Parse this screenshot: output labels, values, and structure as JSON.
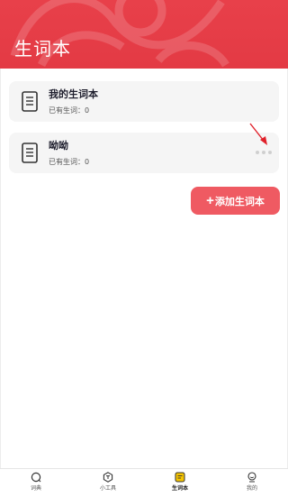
{
  "header": {
    "title": "生词本"
  },
  "wordbooks": [
    {
      "title": "我的生词本",
      "count_text": "已有生词：0"
    },
    {
      "title": "呦呦",
      "count_text": "已有生词：0"
    }
  ],
  "add_button": {
    "label": "添加生词本"
  },
  "tabs": [
    {
      "label": "词典",
      "icon": "search-icon"
    },
    {
      "label": "小工具",
      "icon": "tools-icon"
    },
    {
      "label": "生词本",
      "icon": "notebook-icon",
      "active": true
    },
    {
      "label": "我的",
      "icon": "profile-icon"
    }
  ],
  "colors": {
    "brand_red": "#e33a44",
    "button_red": "#ef5a62",
    "card_bg": "#f5f5f5",
    "active_tab": "#f0b400"
  }
}
